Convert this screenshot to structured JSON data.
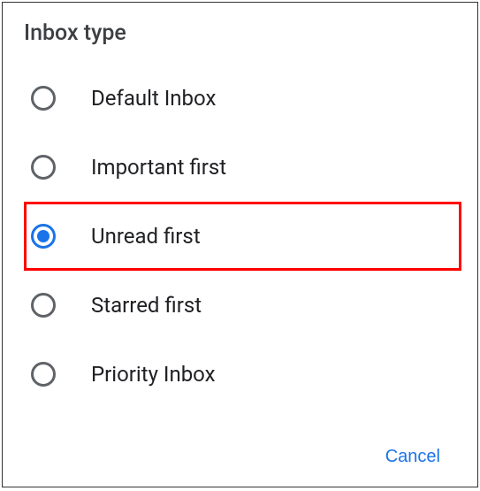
{
  "dialog": {
    "title": "Inbox type",
    "options": [
      {
        "label": "Default Inbox",
        "selected": false,
        "highlighted": false
      },
      {
        "label": "Important first",
        "selected": false,
        "highlighted": false
      },
      {
        "label": "Unread first",
        "selected": true,
        "highlighted": true
      },
      {
        "label": "Starred first",
        "selected": false,
        "highlighted": false
      },
      {
        "label": "Priority Inbox",
        "selected": false,
        "highlighted": false
      }
    ],
    "cancel_label": "Cancel"
  }
}
